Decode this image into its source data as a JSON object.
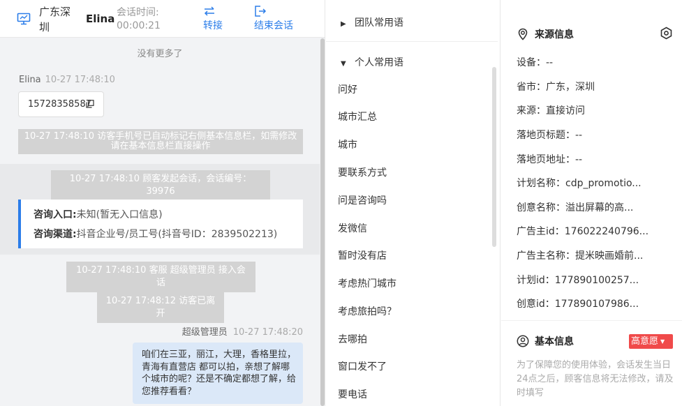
{
  "header": {
    "location": "广东深圳",
    "visitor_name": "Elina",
    "session_time_label": "会话时间:",
    "session_time_value": "00:00:21",
    "transfer_label": "转接",
    "end_label": "结束会话"
  },
  "chat": {
    "no_more": "没有更多了",
    "visitor_msg": {
      "sender": "Elina",
      "time": "10-27 17:48:10",
      "phone": "15728358587"
    },
    "sys_phone_marked": "10-27 17:48:10 访客手机号已自动标记右侧基本信息栏，如需修改请在基本信息栏直接操作",
    "sys_session_start": "10-27 17:48:10 顾客发起会话，会话编号：39976",
    "consult": {
      "entry_label": "咨询入口:",
      "entry_value": "未知(暂无入口信息)",
      "channel_label": "咨询渠道:",
      "channel_value": "抖音企业号/员工号(抖音号ID：2839502213)"
    },
    "sys_agent_join": "10-27 17:48:10 客服 超级管理员 接入会话",
    "sys_visitor_left": "10-27 17:48:12 访客已离开",
    "agent_msg": {
      "sender": "超级管理员",
      "time": "10-27 17:48:20",
      "text": "咱们在三亚，丽江，大理，香格里拉，青海有直营店 都可以拍，亲想了解哪个城市的呢？还是不确定都想了解，给您推荐看看？"
    }
  },
  "phrases": {
    "team_group": "团队常用语",
    "personal_group": "个人常用语",
    "items": [
      "问好",
      "城市汇总",
      "城市",
      "要联系方式",
      "问是咨询吗",
      "发微信",
      "暂时没有店",
      "考虑热门城市",
      "考虑旅拍吗？",
      "去哪拍",
      "窗口发不了",
      "要电话"
    ]
  },
  "info": {
    "source_title": "来源信息",
    "fields": [
      "设备：--",
      "省市：广东，深圳",
      "来源：直接访问",
      "落地页标题：--",
      "落地页地址：--",
      "计划名称：cdp_promotio...",
      "创意名称：溢出屏幕的高...",
      "广告主id：176022240796...",
      "广告主名称：提米映画婚前...",
      "计划id：177890100257...",
      "创意id：177890107986..."
    ],
    "basic_title": "基本信息",
    "intent_tag": "高意愿",
    "note": "为了保障您的使用体验，会话发生当日24点之后，顾客信息将无法修改，请及时填写"
  },
  "colors": {
    "accent": "#2b7de9",
    "tag_red": "#f04a4a",
    "agent_bubble": "#dbe8f8"
  }
}
